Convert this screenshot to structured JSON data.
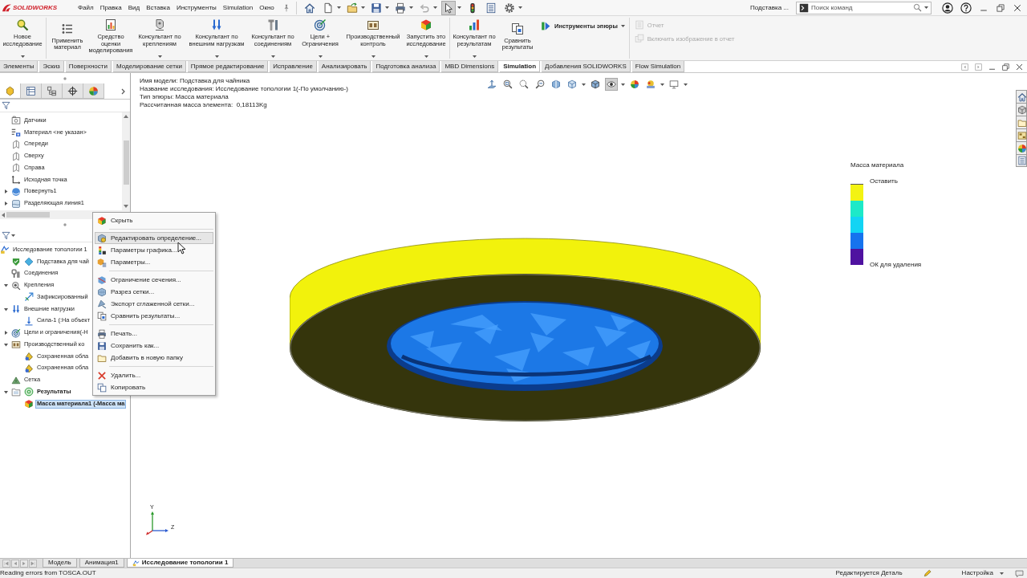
{
  "titlebar": {
    "logo_text": "SOLIDWORKS",
    "menu": [
      "Файл",
      "Правка",
      "Вид",
      "Вставка",
      "Инструменты",
      "Simulation",
      "Окно"
    ],
    "document": "Подставка ...",
    "search": {
      "placeholder": "Поиск команд"
    }
  },
  "quick_toolbar": [
    {
      "dropdown": false,
      "pressed": false,
      "disabled": false
    },
    {
      "dropdown": true,
      "pressed": false,
      "disabled": false
    },
    {
      "dropdown": true,
      "pressed": false,
      "disabled": false
    },
    {
      "dropdown": true,
      "pressed": false,
      "disabled": false
    },
    {
      "dropdown": true,
      "pressed": false,
      "disabled": false
    },
    {
      "dropdown": true,
      "pressed": false,
      "disabled": true
    },
    {
      "dropdown": true,
      "pressed": true,
      "disabled": false
    },
    {
      "dropdown": false,
      "pressed": false,
      "disabled": false
    },
    {
      "dropdown": false,
      "pressed": false,
      "disabled": false
    },
    {
      "dropdown": true,
      "pressed": false,
      "disabled": false
    }
  ],
  "command_manager": {
    "buttons": [
      {
        "label": "Новое\nисследование",
        "dropdown": true
      },
      {
        "label": "Применить\nматериал",
        "dropdown": false
      },
      {
        "label": "Средство\nоценки\nмоделирования",
        "dropdown": false
      },
      {
        "label": "Консультант по\nкреплениям",
        "dropdown": true
      },
      {
        "label": "Консультант по\nвнешним нагрузкам",
        "dropdown": true
      },
      {
        "label": "Консультант по\nсоединениям",
        "dropdown": true
      },
      {
        "label": "Цели +\nОграничения",
        "dropdown": true
      },
      {
        "label": "Производственный\nконтроль",
        "dropdown": true
      },
      {
        "label": "Запустить это\nисследование",
        "dropdown": true
      },
      {
        "label": "Консультант по\nрезультатам",
        "dropdown": true
      },
      {
        "label": "Сравнить\nрезультаты",
        "dropdown": false
      }
    ],
    "plot_tools": {
      "label": "Инструменты эпюры",
      "dropdown": true
    },
    "report": [
      {
        "label": "Отчет",
        "disabled": true
      },
      {
        "label": "Включить изображение в отчет",
        "disabled": true
      }
    ]
  },
  "ribbon_tabs": [
    {
      "label": "Элементы",
      "selected": false
    },
    {
      "label": "Эскиз",
      "selected": false
    },
    {
      "label": "Поверхности",
      "selected": false
    },
    {
      "label": "Моделирование сетки",
      "selected": false
    },
    {
      "label": "Прямое редактирование",
      "selected": false
    },
    {
      "label": "Исправление",
      "selected": false
    },
    {
      "label": "Анализировать",
      "selected": false
    },
    {
      "label": "Подготовка анализа",
      "selected": false
    },
    {
      "label": "MBD Dimensions",
      "selected": false
    },
    {
      "label": "Simulation",
      "selected": true
    },
    {
      "label": "Добавления SOLIDWORKS",
      "selected": false
    },
    {
      "label": "Flow Simulation",
      "selected": false
    }
  ],
  "feature_manager": {
    "tabs": [
      {
        "selected": true
      },
      {
        "selected": false
      },
      {
        "selected": false
      },
      {
        "selected": false
      },
      {
        "selected": false
      }
    ],
    "items": [
      {
        "label": "Датчики",
        "selected": false
      },
      {
        "label": "Материал <не указан>",
        "selected": false
      },
      {
        "label": "Спереди",
        "selected": false
      },
      {
        "label": "Сверху",
        "selected": false
      },
      {
        "label": "Справа",
        "selected": false
      },
      {
        "label": "Исходная точка",
        "selected": false
      },
      {
        "label": "Повернуть1",
        "selected": false,
        "expanded": false
      },
      {
        "label": "Разделяющая линия1",
        "selected": false,
        "expanded": false
      }
    ]
  },
  "simulation_tree": {
    "items": [
      {
        "label": "Исследование топологии 1",
        "selected": false,
        "children": [
          {
            "label": "Подставка для чай",
            "selected": false
          },
          {
            "label": "Соединения",
            "selected": false
          },
          {
            "label": "Крепления",
            "selected": false,
            "expanded": true,
            "children": [
              {
                "label": "Зафиксированный",
                "selected": false
              }
            ]
          },
          {
            "label": "Внешние нагрузки",
            "selected": false,
            "expanded": true,
            "children": [
              {
                "label": "Сила-1 (:На объект",
                "selected": false
              }
            ]
          },
          {
            "label": "Цели и ограничения(-Н",
            "selected": false,
            "expanded": false
          },
          {
            "label": "Производственный ко",
            "selected": false,
            "expanded": true,
            "children": [
              {
                "label": "Сохраненная обла",
                "selected": false
              },
              {
                "label": "Сохраненная обла",
                "selected": false
              }
            ]
          },
          {
            "label": "Сетка",
            "selected": false
          },
          {
            "label": "Результаты",
            "selected": false,
            "bold": true,
            "expanded": true,
            "children": [
              {
                "label": "Масса материала1 (-Масса ма",
                "selected": true,
                "bold": true
              }
            ]
          }
        ]
      }
    ]
  },
  "context_menu": {
    "groups": [
      [
        {
          "label": "Скрыть",
          "highlighted": false
        }
      ],
      [
        {
          "label": "Редактировать определение...",
          "highlighted": true
        },
        {
          "label": "Параметры графика...",
          "highlighted": false
        },
        {
          "label": "Параметры...",
          "highlighted": false
        }
      ],
      [
        {
          "label": "Ограничение сечения...",
          "highlighted": false
        },
        {
          "label": "Разрез сетки...",
          "highlighted": false
        },
        {
          "label": "Экспорт сглаженной сетки...",
          "highlighted": false
        },
        {
          "label": "Сравнить результаты...",
          "highlighted": false
        }
      ],
      [
        {
          "label": "Печать...",
          "highlighted": false
        },
        {
          "label": "Сохранить как...",
          "highlighted": false
        },
        {
          "label": "Добавить в новую папку",
          "highlighted": false
        }
      ],
      [
        {
          "label": "Удалить...",
          "highlighted": false
        },
        {
          "label": "Копировать",
          "highlighted": false
        }
      ]
    ]
  },
  "graphics": {
    "info": [
      "Имя модели: Подставка для чайника",
      "Название исследования: Исследование топологии 1(-По умолчанию-)",
      "Тип эпюры: Масса материала",
      "Рассчитанная масса элемента:  0,18113Kg"
    ],
    "view_toolbar": [
      {
        "dropdown": false,
        "pressed": false
      },
      {
        "dropdown": false,
        "pressed": false
      },
      {
        "dropdown": false,
        "pressed": false
      },
      {
        "dropdown": false,
        "pressed": false
      },
      {
        "dropdown": false,
        "pressed": false
      },
      {
        "dropdown": true,
        "pressed": false
      },
      {
        "dropdown": false,
        "pressed": false
      },
      {
        "dropdown": true,
        "pressed": true
      },
      {
        "dropdown": false,
        "pressed": false
      },
      {
        "dropdown": true,
        "pressed": false
      },
      {
        "dropdown": true,
        "pressed": false
      }
    ],
    "legend": {
      "title": "Масса материала",
      "top_label": "Оставить",
      "bottom_label": "ОК для удаления",
      "bands": [
        {
          "color": "#f3f313"
        },
        {
          "color": "#1de9c8"
        },
        {
          "color": "#12d4f4"
        },
        {
          "color": "#1673ee"
        },
        {
          "color": "#4f12a0"
        }
      ]
    },
    "triad_labels": [
      "Y",
      "Z"
    ]
  },
  "document_tabs": [
    {
      "label": "Модель",
      "selected": false
    },
    {
      "label": "Анимация1",
      "selected": false
    },
    {
      "label": "Исследование топологии 1",
      "selected": true
    }
  ],
  "status_bar": {
    "message": "Reading errors from TOSCA.OUT",
    "mode": "Редактируется Деталь",
    "units": "Настройка"
  }
}
